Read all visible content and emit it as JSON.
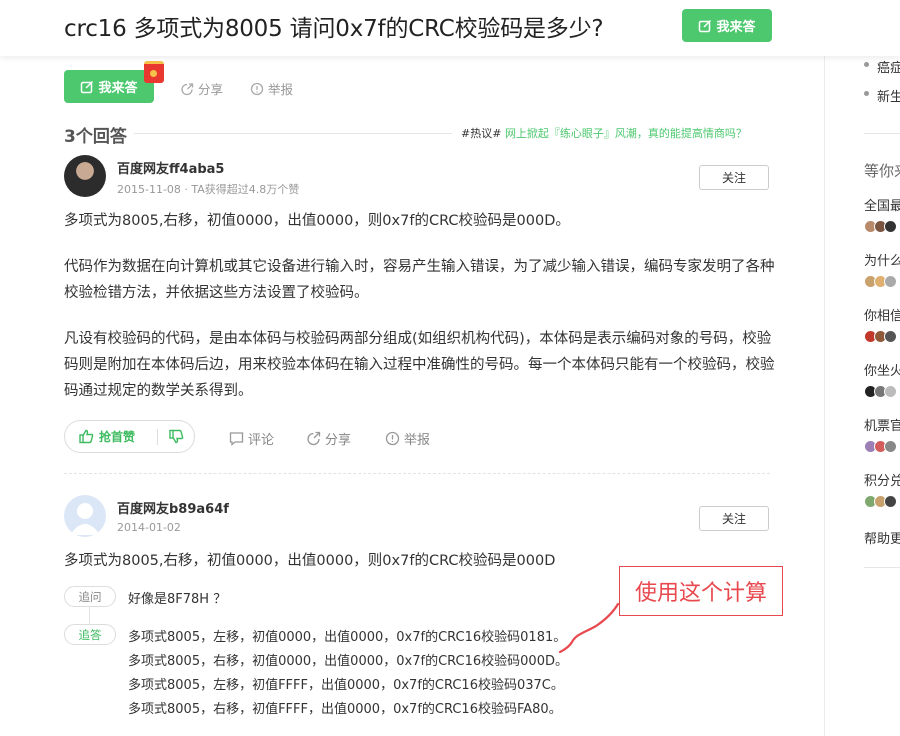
{
  "header": {
    "question_title": "crc16 多项式为8005 请问0x7f的CRC校验码是多少?",
    "answer_button": "我来答"
  },
  "actions": {
    "answer_button": "我来答",
    "share": "分享",
    "report": "举报"
  },
  "answers_heading": {
    "count": "3个回答",
    "hot_tag": "#热议#",
    "hot_link": "网上掀起『练心眼子』风潮，真的能提高情商吗？"
  },
  "answers": [
    {
      "user": "百度网友ff4aba5",
      "meta": "2015-11-08 · TA获得超过4.8万个赞",
      "follow": "关注",
      "paragraphs": [
        "多项式为8005,右移，初值0000，出值0000，则0x7f的CRC校验码是000D。",
        "代码作为数据在向计算机或其它设备进行输入时，容易产生输入错误，为了减少输入错误，编码专家发明了各种校验检错方法，并依据这些方法设置了校验码。",
        "凡设有校验码的代码，是由本体码与校验码两部分组成(如组织机构代码)，本体码是表示编码对象的号码，校验码则是附加在本体码后边，用来校验本体码在输入过程中准确性的号码。每一个本体码只能有一个校验码，校验码通过规定的数学关系得到。"
      ],
      "vote_label": "抢首赞",
      "comment": "评论",
      "share": "分享",
      "report": "举报"
    },
    {
      "user": "百度网友b89a64f",
      "meta": "2014-01-02",
      "follow": "关注",
      "paragraphs": [
        "多项式为8005,右移，初值0000，出值0000，则0x7f的CRC校验码是000D"
      ],
      "followup_tag": "追问",
      "followup_text": "好像是8F78H ？",
      "reply_tag": "追答",
      "reply_lines": [
        "多项式8005，左移，初值0000，出值0000，0x7f的CRC16校验码0181。",
        "多项式8005，右移，初值0000，出值0000，0x7f的CRC16校验码000D。",
        "多项式8005，左移，初值FFFF，出值0000，0x7f的CRC16校验码037C。",
        "多项式8005，右移，初值FFFF，出值0000，0x7f的CRC16校验码FA80。"
      ]
    }
  ],
  "annotation": {
    "text": "使用这个计算",
    "color": "#e8494f"
  },
  "sidebar": {
    "top_items": [
      "癌症",
      "新生"
    ],
    "heading": "等你来",
    "items": [
      "全国最",
      "为什么",
      "你相信",
      "你坐火",
      "机票官",
      "积分兑"
    ],
    "help": "帮助更"
  },
  "colors": {
    "brand_green": "#4dc86f",
    "vote_green": "#3dbb5f",
    "hongbao_red": "#e8382f"
  }
}
